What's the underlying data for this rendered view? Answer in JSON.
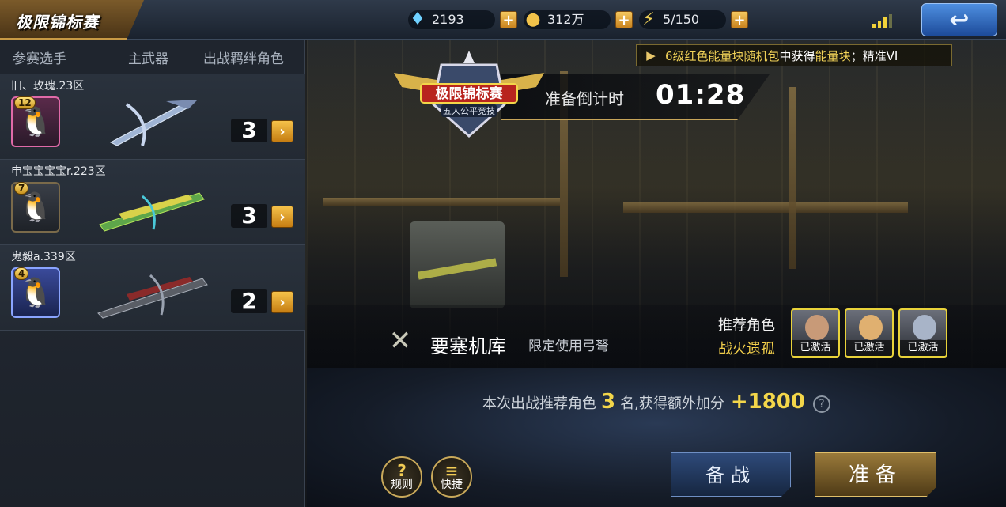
{
  "header": {
    "title": "极限锦标赛",
    "currencies": [
      {
        "icon": "diamond-icon",
        "value": "2193"
      },
      {
        "icon": "gold-coin-icon",
        "value": "312万"
      },
      {
        "icon": "energy-bolt-icon",
        "value": "5/150"
      }
    ],
    "plus_label": "+",
    "signal_icon": "signal-bars-icon",
    "back_icon": "back-arrow-icon"
  },
  "left_panel": {
    "columns": [
      "参赛选手",
      "主武器",
      "出战羁绊角色"
    ],
    "players": [
      {
        "name": "旧、玫瑰.23区",
        "level": "12",
        "count": "3",
        "frame_color": "#e06aa8"
      },
      {
        "name": "申宝宝宝宝r.223区",
        "level": "7",
        "count": "3",
        "frame_color": "#3a3f48"
      },
      {
        "name": "鬼毅a.339区",
        "level": "4",
        "count": "2",
        "frame_color": "#5a7ae8"
      }
    ]
  },
  "scene": {
    "ticker": {
      "prefix": "6级红色能量块随机包",
      "mid": "中获得",
      "highlight": "能量块",
      "suffix": "；精准VI"
    },
    "emblem": {
      "title": "极限锦标赛",
      "subtitle": "五人公平竞技"
    },
    "countdown": {
      "label": "准备倒计时",
      "value": "01:28"
    },
    "map": {
      "name": "要塞机库",
      "note": "限定使用弓弩",
      "icon": "crossed-arrows-icon"
    },
    "recommend": {
      "label": "推荐角色",
      "subtitle": "战火遗孤",
      "tag": "已激活",
      "count": 3
    }
  },
  "bottom": {
    "bonus_prefix": "本次出战推荐角色",
    "bonus_count": "3",
    "bonus_mid": "名,获得额外加分",
    "bonus_points": "+1800",
    "help_label": "?",
    "rules_label": "规则",
    "quick_label": "快捷",
    "prepare_label": "备战",
    "ready_label": "准备"
  },
  "colors": {
    "accent_gold": "#f3d64a",
    "ticker_gold": "#f1d258",
    "ready_button": "#9a7a3a",
    "prepare_button": "#2e4a7a"
  }
}
